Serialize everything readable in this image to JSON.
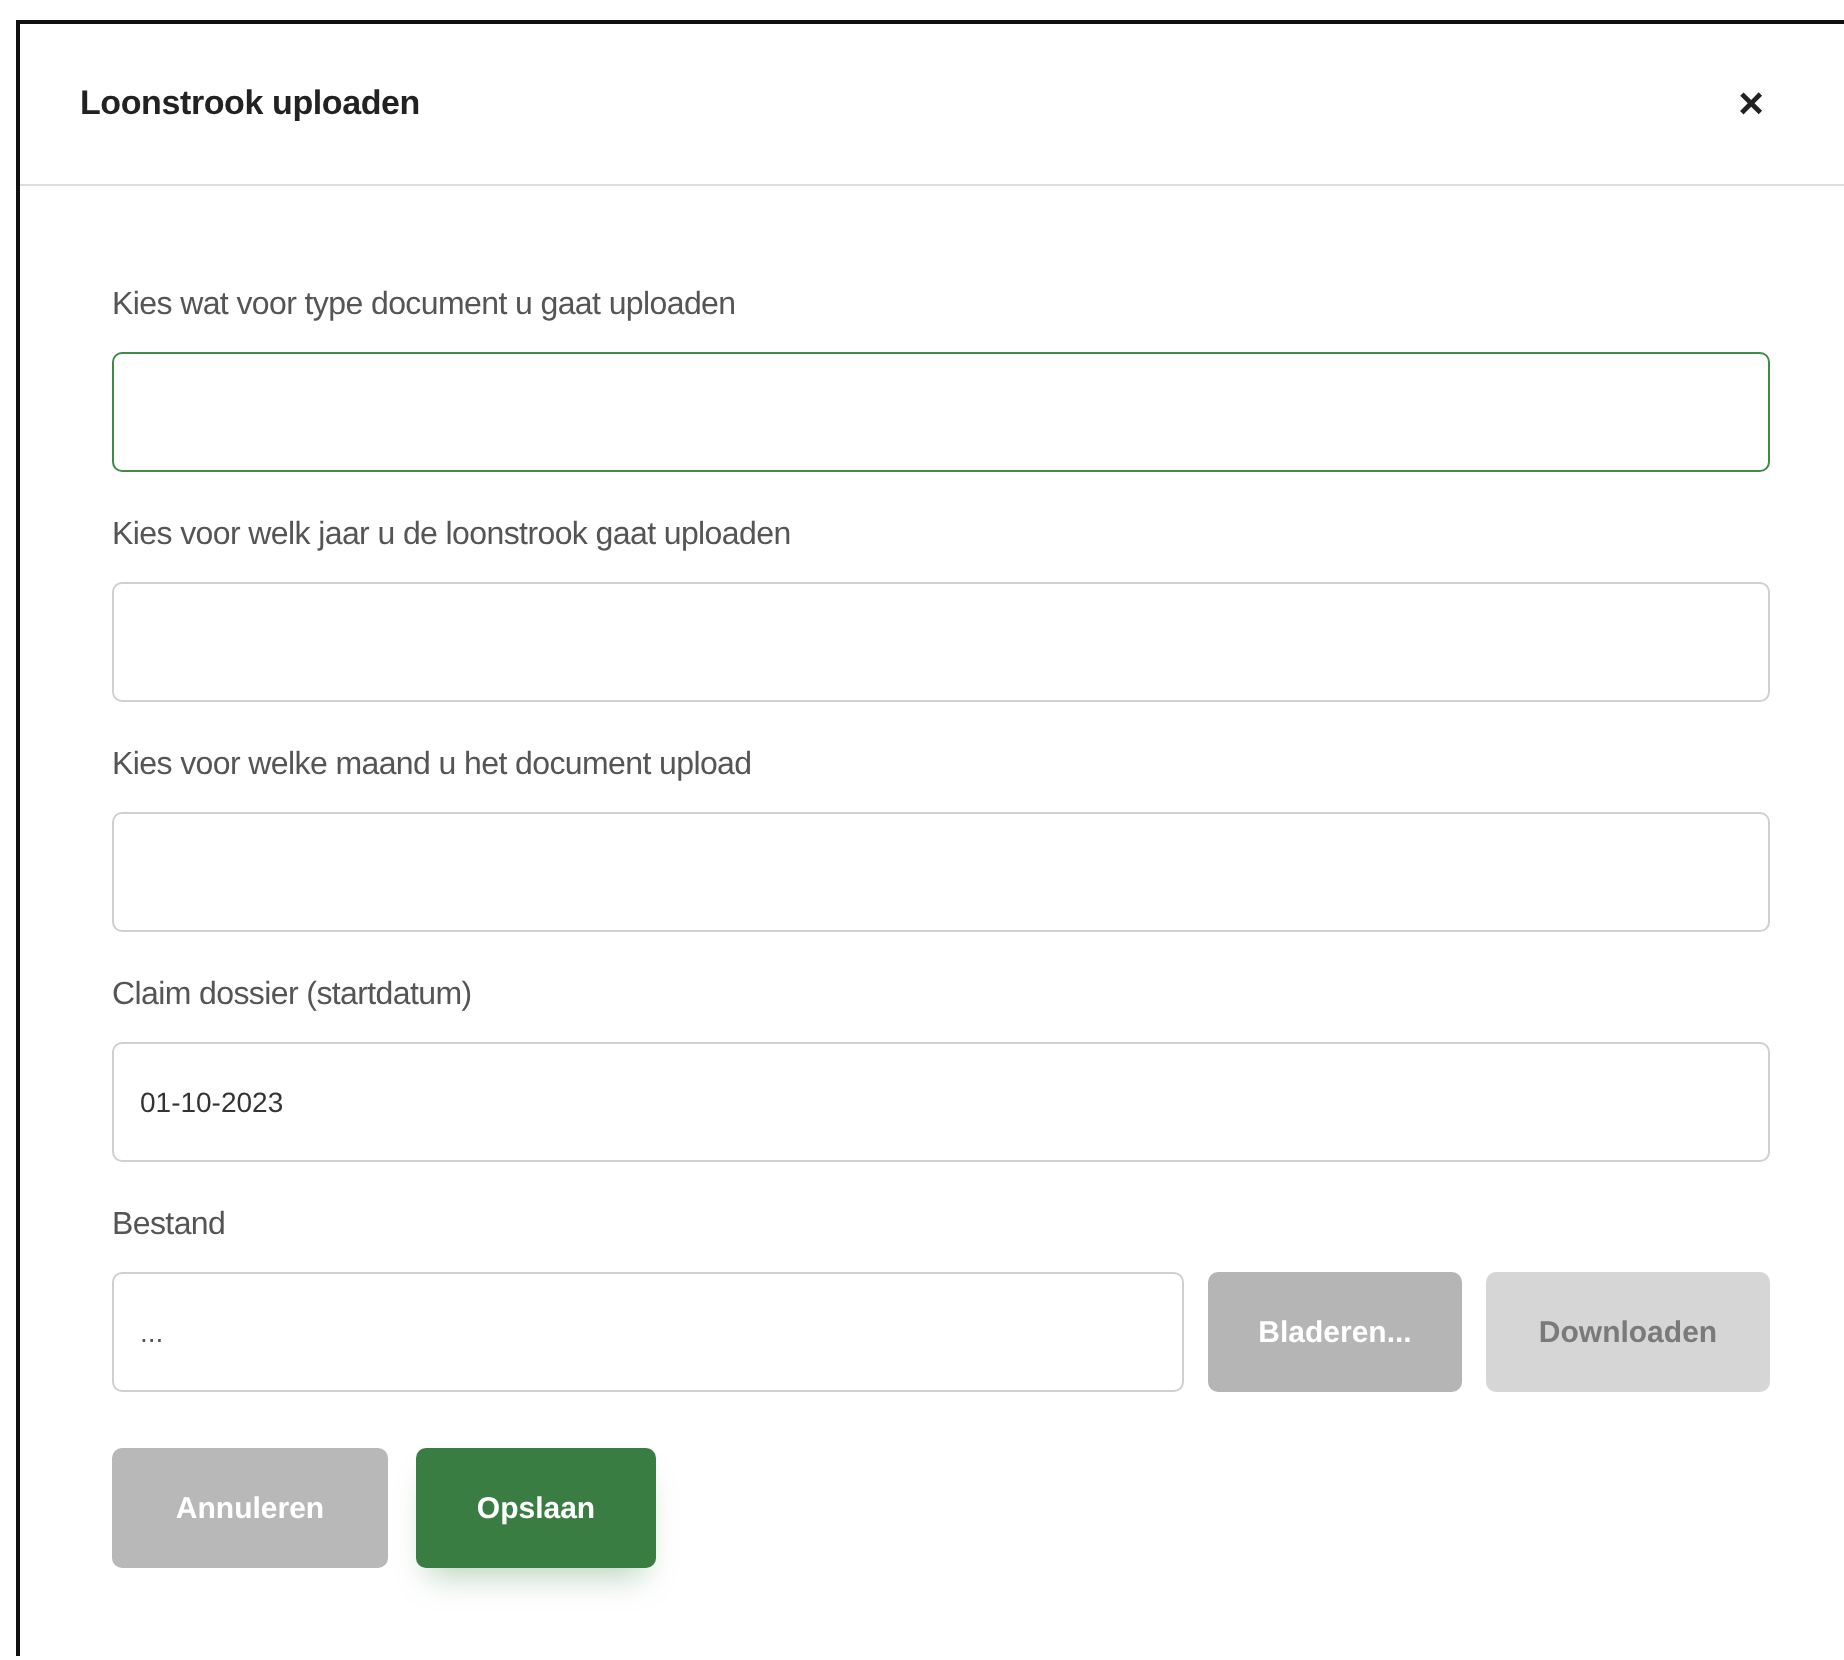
{
  "dialog": {
    "title": "Loonstrook uploaden",
    "close": "×"
  },
  "fields": [
    {
      "label": "Kies wat voor type document u gaat uploaden",
      "focused": true
    },
    {
      "label": "Kies voor welk jaar u de loonstrook gaat uploaden",
      "focused": false
    },
    {
      "label": "Kies voor welke maand u het document upload",
      "focused": false
    },
    {
      "label": "Claim dossier (startdatum)",
      "value": "01-10-2023",
      "focused": false
    }
  ],
  "file": {
    "label": "Bestand",
    "value": "...",
    "buttons": [
      {
        "label": "Bladeren...",
        "disabled": false
      },
      {
        "label": "Downloaden",
        "disabled": true
      }
    ]
  },
  "actions": [
    {
      "label": "Annuleren",
      "kind": "secondary"
    },
    {
      "label": "Opslaan",
      "kind": "primary"
    }
  ]
}
